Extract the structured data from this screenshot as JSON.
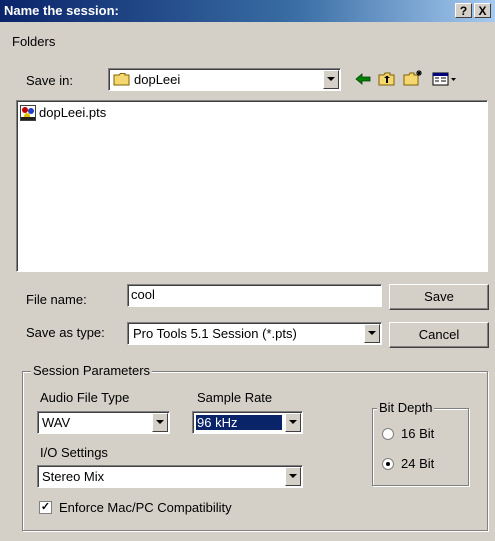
{
  "window": {
    "title": "Name the session:",
    "help_label": "?",
    "close_label": "X"
  },
  "menubar": {
    "folders": "Folders"
  },
  "savein": {
    "label": "Save in:",
    "value": "dopLeei",
    "icons": [
      "back-arrow-icon",
      "up-folder-icon",
      "new-folder-icon",
      "view-menu-icon"
    ]
  },
  "files": [
    {
      "name": "dopLeei.pts",
      "icon": "pro-tools-session-icon"
    }
  ],
  "filename": {
    "label": "File name:",
    "value": "cool"
  },
  "saveas": {
    "label": "Save as type:",
    "value": "Pro Tools 5.1 Session (*.pts)"
  },
  "buttons": {
    "save": "Save",
    "cancel": "Cancel"
  },
  "session_params": {
    "title": "Session Parameters",
    "audio_file_type": {
      "label": "Audio File Type",
      "value": "WAV"
    },
    "sample_rate": {
      "label": "Sample Rate",
      "value": "96 kHz"
    },
    "io_settings": {
      "label": "I/O Settings",
      "value": "Stereo Mix"
    },
    "bit_depth": {
      "label": "Bit Depth",
      "options": [
        "16 Bit",
        "24 Bit"
      ],
      "selected": "24 Bit"
    },
    "enforce": {
      "label": "Enforce Mac/PC Compatibility",
      "checked": true
    }
  }
}
